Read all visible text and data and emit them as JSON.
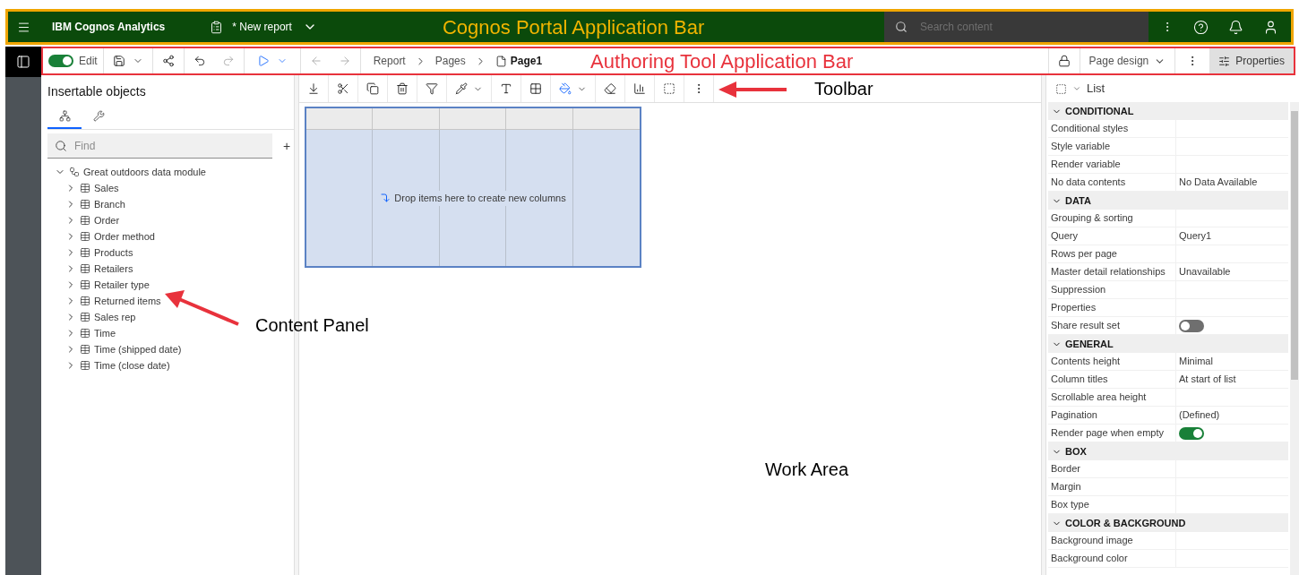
{
  "portal_bar": {
    "app_name": "IBM Cognos Analytics",
    "report_title": "* New report",
    "search": {
      "placeholder": "Search content"
    },
    "annotation": "Cognos Portal Application Bar"
  },
  "authoring_bar": {
    "edit_toggle": {
      "label": "Edit",
      "on": true
    },
    "breadcrumbs": [
      {
        "label": "Report",
        "current": false
      },
      {
        "label": "Pages",
        "current": false
      },
      {
        "label": "Page1",
        "current": true
      }
    ],
    "annotation": "Authoring Tool Application Bar",
    "view_menu": "Page design",
    "properties_button": {
      "label": "Properties",
      "selected": true
    }
  },
  "content_panel": {
    "title": "Insertable objects",
    "tabs": [
      {
        "kind": "tree",
        "selected": true
      },
      {
        "kind": "tools",
        "selected": false
      }
    ],
    "find": {
      "placeholder": "Find"
    },
    "add_label": "+",
    "tree": {
      "label": "Great outdoors data module",
      "expanded": true,
      "children": [
        {
          "label": "Sales",
          "expanded": false
        },
        {
          "label": "Branch",
          "expanded": false
        },
        {
          "label": "Order",
          "expanded": false
        },
        {
          "label": "Order method",
          "expanded": false
        },
        {
          "label": "Products",
          "expanded": false
        },
        {
          "label": "Retailers",
          "expanded": false
        },
        {
          "label": "Retailer type",
          "expanded": false
        },
        {
          "label": "Returned items",
          "expanded": false
        },
        {
          "label": "Sales rep",
          "expanded": false
        },
        {
          "label": "Time",
          "expanded": false
        },
        {
          "label": "Time (shipped date)",
          "expanded": false
        },
        {
          "label": "Time (close date)",
          "expanded": false
        }
      ]
    },
    "annotation": "Content Panel"
  },
  "work_area": {
    "toolbar_annotation": "Toolbar",
    "drop_hint": "Drop items here to create new columns",
    "annotation": "Work Area"
  },
  "properties_panel": {
    "title": "List",
    "sections": [
      {
        "title": "CONDITIONAL",
        "expanded": true,
        "rows": [
          {
            "kind": "text",
            "label": "Conditional styles"
          },
          {
            "kind": "text",
            "label": "Style variable"
          },
          {
            "kind": "text",
            "label": "Render variable"
          },
          {
            "kind": "text",
            "label": "No data contents",
            "value": "No Data Available"
          }
        ]
      },
      {
        "title": "DATA",
        "expanded": true,
        "rows": [
          {
            "kind": "text",
            "label": "Grouping & sorting"
          },
          {
            "kind": "text",
            "label": "Query",
            "value": "Query1"
          },
          {
            "kind": "text",
            "label": "Rows per page"
          },
          {
            "kind": "text",
            "label": "Master detail relationships",
            "value": "Unavailable"
          },
          {
            "kind": "text",
            "label": "Suppression"
          },
          {
            "kind": "text",
            "label": "Properties"
          },
          {
            "kind": "toggle",
            "label": "Share result set",
            "on": false
          }
        ]
      },
      {
        "title": "GENERAL",
        "expanded": true,
        "rows": [
          {
            "kind": "text",
            "label": "Contents height",
            "value": "Minimal"
          },
          {
            "kind": "text",
            "label": "Column titles",
            "value": "At start of list"
          },
          {
            "kind": "text",
            "label": "Scrollable area height"
          },
          {
            "kind": "text",
            "label": "Pagination",
            "value": "(Defined)"
          },
          {
            "kind": "toggle",
            "label": "Render page when empty",
            "on": true
          }
        ]
      },
      {
        "title": "BOX",
        "expanded": true,
        "rows": [
          {
            "kind": "text",
            "label": "Border"
          },
          {
            "kind": "text",
            "label": "Margin"
          },
          {
            "kind": "text",
            "label": "Box type"
          }
        ]
      },
      {
        "title": "COLOR & BACKGROUND",
        "expanded": true,
        "rows": [
          {
            "kind": "text",
            "label": "Background image"
          },
          {
            "kind": "text",
            "label": "Background color"
          }
        ]
      }
    ]
  }
}
